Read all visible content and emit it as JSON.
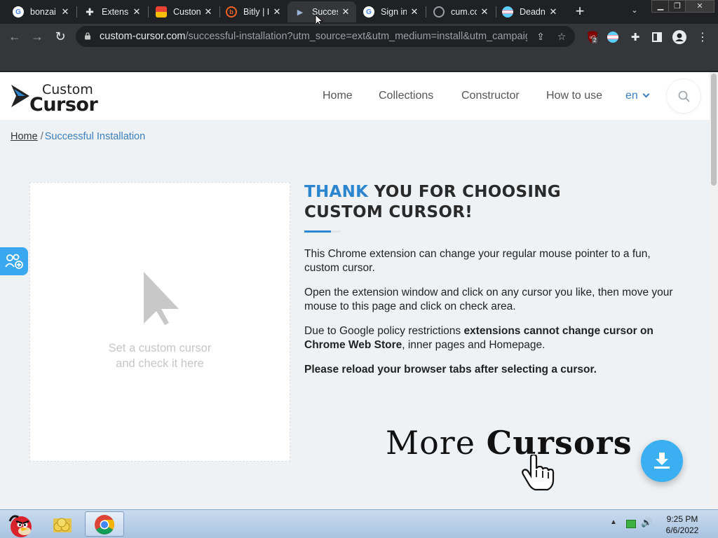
{
  "browser": {
    "tabs": [
      {
        "label": "bonzai",
        "favicon": "google-icon",
        "active": false
      },
      {
        "label": "Extensi",
        "favicon": "puzzle-icon",
        "active": false
      },
      {
        "label": "Custon",
        "favicon": "store-icon",
        "active": false
      },
      {
        "label": "Bitly | I",
        "favicon": "bitly-icon",
        "active": false
      },
      {
        "label": "Succes",
        "favicon": "cursor-icon",
        "active": true
      },
      {
        "label": "Sign in",
        "favicon": "google-icon",
        "active": false
      },
      {
        "label": "cum.cc",
        "favicon": "globe-icon",
        "active": false
      },
      {
        "label": "Deadn",
        "favicon": "flag-icon",
        "active": false
      }
    ],
    "url_host": "custom-cursor.com",
    "url_path": "/successful-installation?utm_source=ext&utm_medium=install&utm_campaig...",
    "ublock_badge": "2"
  },
  "site": {
    "logo_top": "Custom",
    "logo_bottom": "Cursor",
    "nav": [
      "Home",
      "Collections",
      "Constructor",
      "How to use"
    ],
    "language": "en"
  },
  "breadcrumb": {
    "home": "Home",
    "separator": "/",
    "current": "Successful Installation"
  },
  "check_area": {
    "line1": "Set a custom cursor",
    "line2": "and check it here"
  },
  "content": {
    "title_accent": "THANK",
    "title_rest_line1": " YOU FOR CHOOSING",
    "title_line2": "CUSTOM CURSOR!",
    "p1": "This Chrome extension can change your regular mouse pointer to a fun, custom cursor.",
    "p2": "Open the extension window and click on any cursor you like, then move your mouse to this page and click on check area.",
    "p3_pre": "Due to Google policy restrictions ",
    "p3_bold": "extensions cannot change cursor on Chrome Web Store",
    "p3_post": ", inner pages and Homepage.",
    "p4": "Please reload your browser tabs after selecting a cursor.",
    "more_word1": "More",
    "more_word2": "Cursors"
  },
  "taskbar": {
    "time": "9:25 PM",
    "date": "6/6/2022"
  },
  "colors": {
    "accent": "#2c86cf",
    "fab": "#3ab0f2",
    "page_bg": "#eff2f5"
  }
}
